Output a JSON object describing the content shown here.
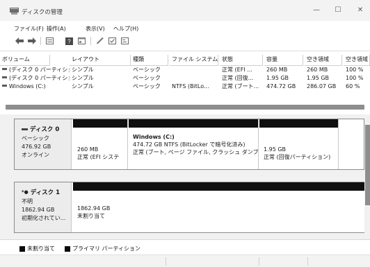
{
  "window": {
    "title": "ディスクの管理",
    "controls": {
      "minimize": "—",
      "maximize": "☐",
      "close": "✕"
    }
  },
  "menu": {
    "items": [
      "ファイル(F)",
      "操作(A)",
      "表示(V)",
      "ヘルプ(H)"
    ]
  },
  "toolbar": {
    "buttons": [
      "back-arrow-icon",
      "forward-arrow-icon",
      "disk-list-icon",
      "help-icon",
      "properties-icon",
      "pen-icon",
      "checkbox-icon",
      "console-icon"
    ]
  },
  "volumes": {
    "columns": [
      "ボリューム",
      "レイアウト",
      "種類",
      "ファイル システム",
      "状態",
      "容量",
      "空き領域",
      "空き領域"
    ],
    "rows": [
      {
        "volume": "(ディスク 0 パーティショ...",
        "layout": "シンプル",
        "type": "ベーシック",
        "fs": "",
        "status": "正常 (EFI ...",
        "capacity": "260 MB",
        "free": "260 MB",
        "pct": "100 %"
      },
      {
        "volume": "(ディスク 0 パーティショ...",
        "layout": "シンプル",
        "type": "ベーシック",
        "fs": "",
        "status": "正常 (回復...",
        "capacity": "1.95 GB",
        "free": "1.95 GB",
        "pct": "100 %"
      },
      {
        "volume": "Windows (C:)",
        "layout": "シンプル",
        "type": "ベーシック",
        "fs": "NTFS (BitLo...",
        "status": "正常 (ブート...",
        "capacity": "474.72 GB",
        "free": "286.07 GB",
        "pct": "60 %"
      }
    ]
  },
  "disks": [
    {
      "name": "ディスク 0",
      "kind": "ベーシック",
      "size": "476.92 GB",
      "state": "オンライン",
      "partitions": [
        {
          "name": "",
          "line1": "260 MB",
          "line2": "正常 (EFI システ"
        },
        {
          "name": "Windows (C:)",
          "line1": "474.72 GB NTFS (BitLocker で暗号化済み)",
          "line2": "正常 (ブート, ページ ファイル, クラッシュ ダンプ, ベ"
        },
        {
          "name": "",
          "line1": "1.95 GB",
          "line2": "正常 (回復パーティション)"
        }
      ]
    },
    {
      "name": "ディスク 1",
      "kind": "不明",
      "size": "1862.94 GB",
      "state": "初期化されてい...",
      "partitions": [
        {
          "name": "",
          "line1": "1862.94 GB",
          "line2": "未割り当て"
        }
      ]
    }
  ],
  "legend": {
    "items": [
      {
        "label": "未割り当て",
        "color": "#0a0a0a"
      },
      {
        "label": "プライマリ パーティション",
        "color": "#0a0a0a"
      }
    ]
  }
}
